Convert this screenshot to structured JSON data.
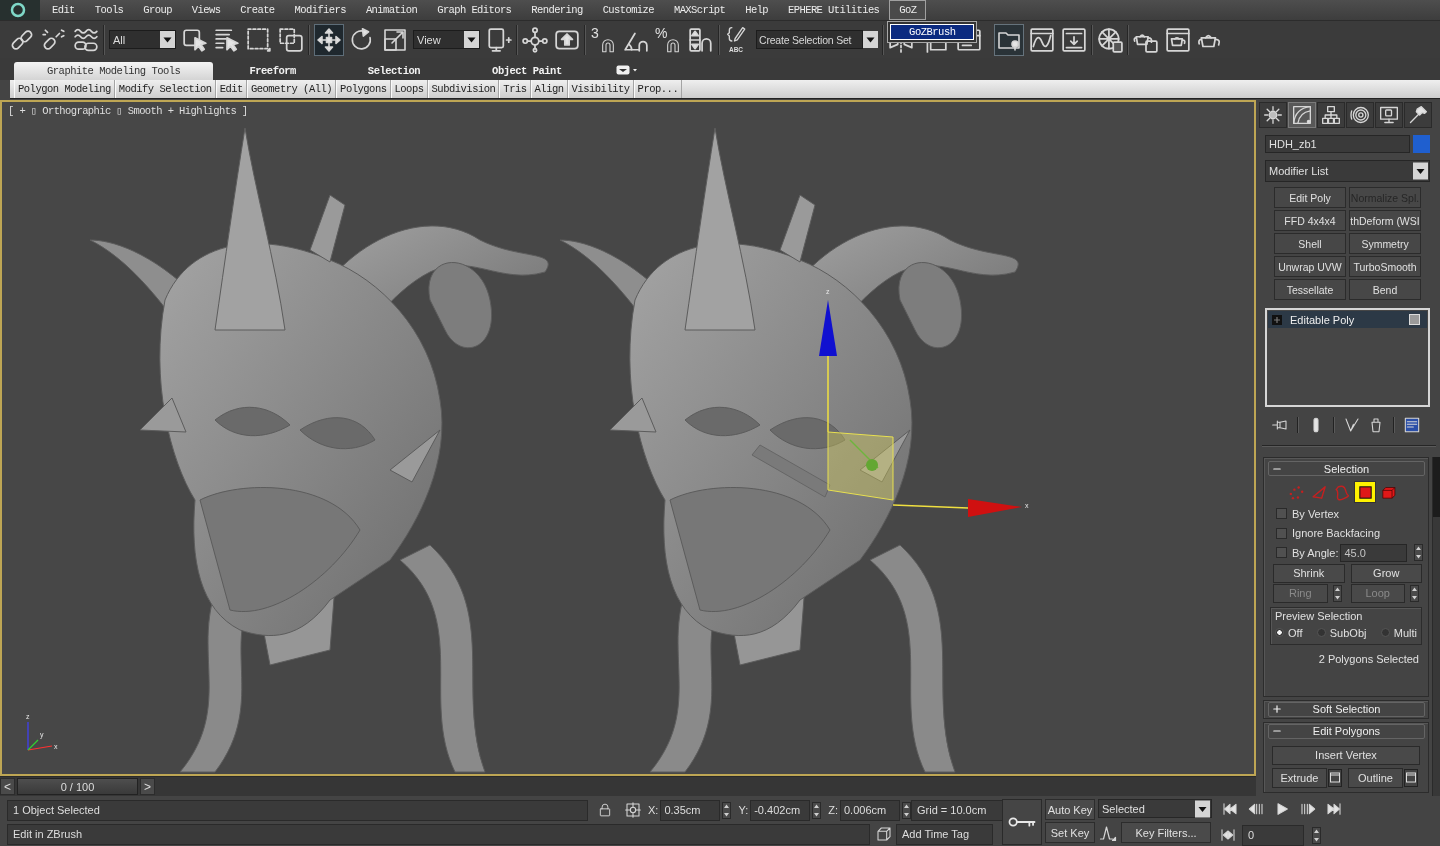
{
  "menu_bar": {
    "items": [
      {
        "label": "Edit",
        "selected": false
      },
      {
        "label": "Tools",
        "selected": false
      },
      {
        "label": "Group",
        "selected": false
      },
      {
        "label": "Views",
        "selected": false
      },
      {
        "label": "Create",
        "selected": false
      },
      {
        "label": "Modifiers",
        "selected": false
      },
      {
        "label": "Animation",
        "selected": false
      },
      {
        "label": "Graph Editors",
        "selected": false
      },
      {
        "label": "Rendering",
        "selected": false
      },
      {
        "label": "Customize",
        "selected": false
      },
      {
        "label": "MAXScript",
        "selected": false
      },
      {
        "label": "Help",
        "selected": false
      },
      {
        "label": "EPHERE Utilities",
        "selected": false
      },
      {
        "label": "GoZ",
        "selected": true
      }
    ]
  },
  "open_menu": {
    "items": [
      {
        "label": "GoZBrush",
        "selected": true
      }
    ]
  },
  "toolbar": {
    "selection_filter": "All",
    "transform_tools": [
      {
        "selected": true
      },
      {
        "selected": false
      },
      {
        "selected": false
      }
    ],
    "reference_coordinate_system": "View",
    "snap_label": "3",
    "percent_snap_label": "%",
    "named_sets_label": "ABC",
    "named_selection_set": {
      "placeholder": "Create Selection Set"
    }
  },
  "ribbon": {
    "tabs": [
      {
        "label": "Graphite Modeling Tools",
        "selected": true
      },
      {
        "label": "Freeform",
        "selected": false
      },
      {
        "label": "Selection",
        "selected": false
      },
      {
        "label": "Object Paint",
        "selected": false
      }
    ],
    "panels": [
      "Polygon Modeling",
      "Modify Selection",
      "Edit",
      "Geometry (All)",
      "Polygons",
      "Loops",
      "Subdivision",
      "Tris",
      "Align",
      "Visibility",
      "Prop..."
    ]
  },
  "viewport": {
    "label": "[ + ▯ Orthographic ▯ Smooth + Highlights ]",
    "active": true,
    "gizmo_labels": {
      "z": "z",
      "x": "x"
    },
    "tripod_labels": {
      "z": "z",
      "y": "y",
      "x": "x"
    }
  },
  "command_panel": {
    "tabs": [
      {
        "selected": false
      },
      {
        "selected": true
      },
      {
        "selected": false
      },
      {
        "selected": false
      },
      {
        "selected": false
      },
      {
        "selected": false
      }
    ],
    "object_name": "HDH_zb1",
    "modifier_list": "Modifier List",
    "modifier_buttons": [
      {
        "label": "Edit Poly",
        "disabled": false
      },
      {
        "label": "Normalize Spl.",
        "disabled": true
      },
      {
        "label": "FFD 4x4x4",
        "disabled": false
      },
      {
        "label": "thDeform (WSI",
        "disabled": false
      },
      {
        "label": "Shell",
        "disabled": false
      },
      {
        "label": "Symmetry",
        "disabled": false
      },
      {
        "label": "Unwrap UVW",
        "disabled": false
      },
      {
        "label": "TurboSmooth",
        "disabled": false
      },
      {
        "label": "Tessellate",
        "disabled": false
      },
      {
        "label": "Bend",
        "disabled": false
      }
    ],
    "stack": [
      {
        "label": "Editable Poly",
        "selected": true,
        "expanded": false
      }
    ],
    "selection": {
      "title": "Selection",
      "expanded": true,
      "levels": [
        {
          "selected": false
        },
        {
          "selected": false
        },
        {
          "selected": false
        },
        {
          "selected": true
        },
        {
          "selected": false
        }
      ],
      "options": [
        {
          "label": "By Vertex",
          "checked": false
        },
        {
          "label": "Ignore Backfacing",
          "checked": false
        }
      ],
      "by_angle": {
        "label": "By Angle:",
        "checked": false,
        "value": "45.0"
      },
      "grow_buttons": [
        {
          "label": "Shrink",
          "disabled": false
        },
        {
          "label": "Grow",
          "disabled": false
        }
      ],
      "loop_buttons": [
        {
          "label": "Ring",
          "disabled": true
        },
        {
          "label": "Loop",
          "disabled": true
        }
      ],
      "preview": {
        "title": "Preview Selection",
        "options": [
          {
            "label": "Off",
            "selected": true
          },
          {
            "label": "SubObj",
            "selected": false
          },
          {
            "label": "Multi",
            "selected": false
          }
        ]
      },
      "status": "2 Polygons Selected"
    },
    "soft_selection": {
      "title": "Soft Selection",
      "expanded": false
    },
    "edit_polygons": {
      "title": "Edit Polygons",
      "expanded": true,
      "buttons": [
        {
          "label": "Insert Vertex",
          "kind": "wide"
        },
        {
          "label": "Extrude",
          "kind": "settings"
        },
        {
          "label": "Outline",
          "kind": "settings"
        }
      ]
    }
  },
  "timeline": {
    "previous": "<",
    "frame": "0 / 100",
    "next": ">",
    "level": 0
  },
  "status_bar": {
    "selection_status": "1 Object Selected",
    "prompt": "Edit in ZBrush",
    "coordinates": [
      {
        "axis": "X:",
        "value": "0.35cm"
      },
      {
        "axis": "Y:",
        "value": "-0.402cm"
      },
      {
        "axis": "Z:",
        "value": "0.006cm"
      }
    ],
    "grid": "Grid = 10.0cm",
    "time_tag": "Add Time Tag",
    "auto_key": "Auto Key",
    "set_key": "Set Key",
    "key_target": "Selected",
    "key_filters": "Key Filters...",
    "current_frame": "0"
  }
}
